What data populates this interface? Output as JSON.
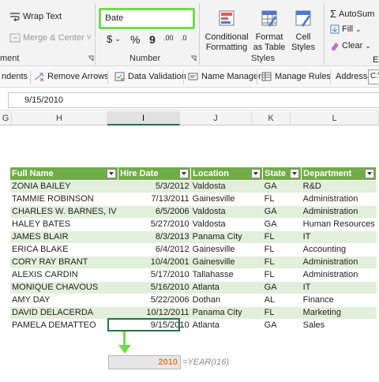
{
  "ribbon": {
    "wrap_text": "Wrap Text",
    "merge_center": "Merge & Center",
    "merge_chevron": "˅",
    "alignment_group_tail": "ment",
    "number_format": "Date",
    "currency_symbol": "$",
    "percent_symbol": "%",
    "comma_symbol": "9",
    "inc_decimal": ".00",
    "dec_decimal": ".0",
    "number_group": "Number",
    "conditional_formatting": "Conditional Formatting",
    "format_as_table": "Format as Table",
    "cell_styles": "Cell Styles",
    "styles_group": "Styles",
    "autosum": "AutoSum",
    "fill": "Fill",
    "clear": "Clear",
    "editing_tail": "E"
  },
  "quick_toolbar": {
    "dependents": "ndents",
    "remove_arrows": "Remove Arrows",
    "data_validation": "Data Validation",
    "name_manager": "Name Manager",
    "manage_rules": "Manage Rules",
    "address_label": "Address:",
    "address_value": "C:\\"
  },
  "formula_bar": {
    "value": "9/15/2010"
  },
  "columns": [
    "G",
    "H",
    "I",
    "J",
    "K",
    "L"
  ],
  "table": {
    "headers": [
      "Full Name",
      "Hire Date",
      "Location",
      "State",
      "Department"
    ],
    "rows": [
      [
        "ZONIA BAILEY",
        "5/3/2012",
        "Valdosta",
        "GA",
        "R&D"
      ],
      [
        "TAMMIE ROBINSON",
        "7/13/2011",
        "Gainesville",
        "FL",
        "Administration"
      ],
      [
        "CHARLES W. BARNES, IV",
        "6/5/2006",
        "Valdosta",
        "GA",
        "Administration"
      ],
      [
        "HALEY BATES",
        "5/27/2010",
        "Valdosta",
        "GA",
        "Human Resources"
      ],
      [
        "JAMES BLAIR",
        "8/3/2013",
        "Panama City",
        "FL",
        "IT"
      ],
      [
        "ERICA BLAKE",
        "6/4/2012",
        "Gainesville",
        "FL",
        "Accounting"
      ],
      [
        "CORY RAY BRANT",
        "10/4/2001",
        "Gainesville",
        "FL",
        "Administration"
      ],
      [
        "ALEXIS CARDIN",
        "5/17/2010",
        "Tallahasse",
        "FL",
        "Administration"
      ],
      [
        "MONIQUE CHAVOUS",
        "5/16/2010",
        "Atlanta",
        "GA",
        "IT"
      ],
      [
        "AMY DAY",
        "5/22/2006",
        "Dothan",
        "AL",
        "Finance"
      ],
      [
        "DAVID DELACERDA",
        "10/12/2011",
        "Panama City",
        "FL",
        "Marketing"
      ],
      [
        "PAMELA DEMATTEO",
        "9/15/2010",
        "Atlanta",
        "GA",
        "Sales"
      ]
    ]
  },
  "result": {
    "value": "2010",
    "formula": "=YEAR(I16)"
  },
  "colors": {
    "accent_green": "#6fdc4c",
    "table_header": "#70ad47",
    "band": "#e2efda",
    "result_text": "#ed7d31",
    "excel_green": "#217346"
  },
  "icons": [
    "wrap-text-icon",
    "merge-center-icon",
    "currency-icon",
    "percent-icon",
    "comma-icon",
    "increase-decimal-icon",
    "decrease-decimal-icon",
    "conditional-formatting-icon",
    "format-as-table-icon",
    "cell-styles-icon",
    "autosum-icon",
    "fill-icon",
    "clear-icon",
    "remove-arrows-icon",
    "data-validation-icon",
    "name-manager-icon",
    "manage-rules-icon",
    "dialog-launcher-icon",
    "filter-dropdown-icon"
  ]
}
